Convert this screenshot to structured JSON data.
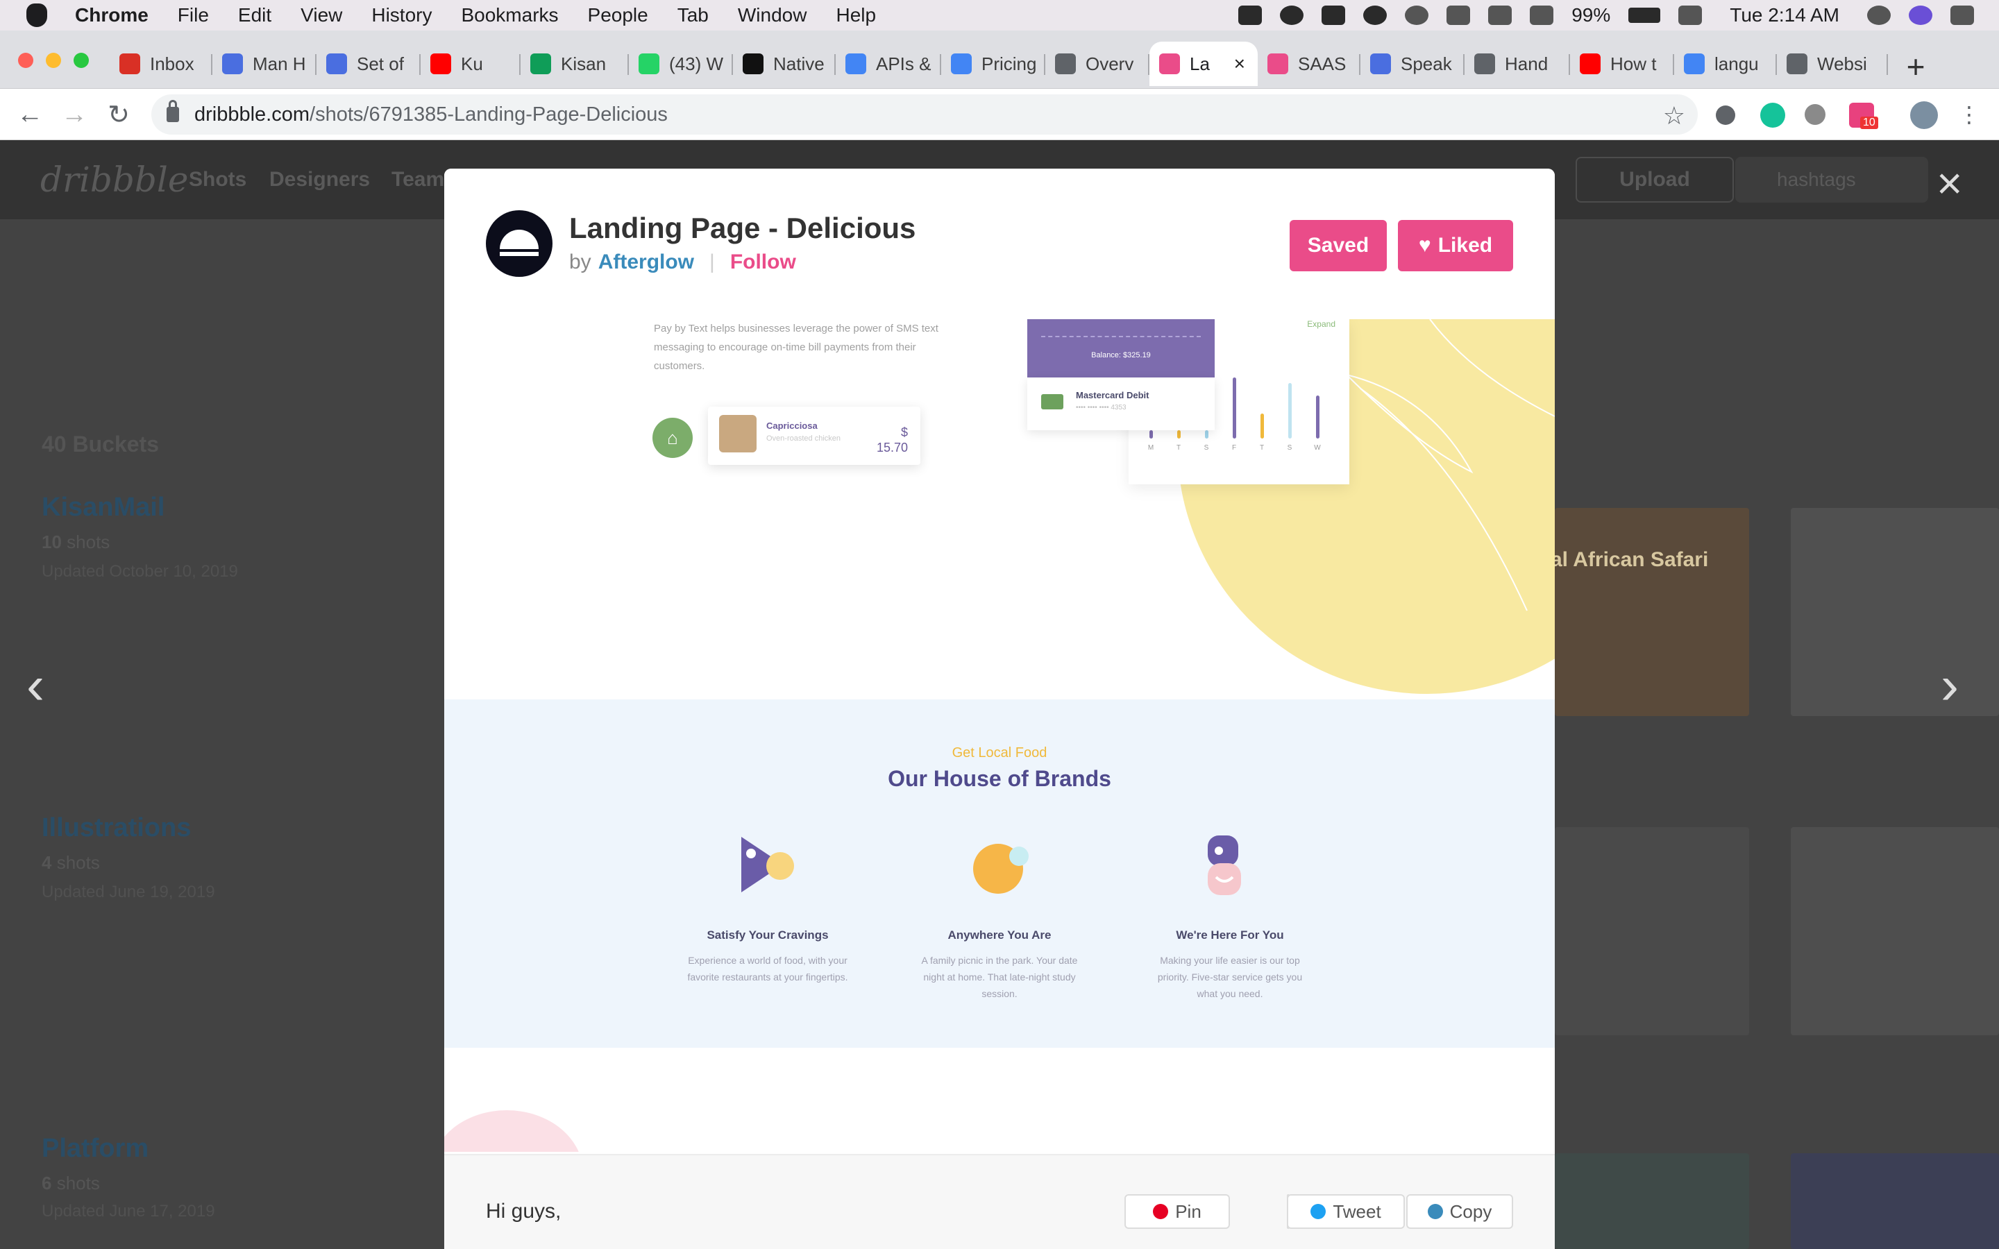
{
  "menubar": {
    "app": "Chrome",
    "items": [
      "File",
      "Edit",
      "View",
      "History",
      "Bookmarks",
      "People",
      "Tab",
      "Window",
      "Help"
    ],
    "battery": "99%",
    "clock": "Tue 2:14 AM"
  },
  "tabs": [
    {
      "title": "Inbox",
      "icon": "gmail-icon",
      "color": "#d93025"
    },
    {
      "title": "Man H",
      "icon": "reddit-icon",
      "color": "#4a6ee0"
    },
    {
      "title": "Set of",
      "icon": "reddit-icon",
      "color": "#4a6ee0"
    },
    {
      "title": "Ku",
      "icon": "youtube-icon",
      "color": "#ff0000"
    },
    {
      "title": "Kisan",
      "icon": "sheets-icon",
      "color": "#0f9d58"
    },
    {
      "title": "(43) W",
      "icon": "whatsapp-icon",
      "color": "#25d366"
    },
    {
      "title": "Native",
      "icon": "medium-icon",
      "color": "#111111"
    },
    {
      "title": "APIs &",
      "icon": "api-icon",
      "color": "#4285f4"
    },
    {
      "title": "Pricing",
      "icon": "gcloud-icon",
      "color": "#4285f4"
    },
    {
      "title": "Overv",
      "icon": "gear-icon",
      "color": "#5f6368"
    },
    {
      "title": "La",
      "icon": "dribbble-icon",
      "color": "#ea4c89",
      "active": true
    },
    {
      "title": "SAAS",
      "icon": "dribbble-icon",
      "color": "#ea4c89"
    },
    {
      "title": "Speak",
      "icon": "reddit-icon",
      "color": "#4a6ee0"
    },
    {
      "title": "Hand",
      "icon": "globe-icon",
      "color": "#5f6368"
    },
    {
      "title": "How t",
      "icon": "youtube-icon",
      "color": "#ff0000"
    },
    {
      "title": "langu",
      "icon": "google-icon",
      "color": "#4285f4"
    },
    {
      "title": "Websi",
      "icon": "globe-icon",
      "color": "#5f6368"
    }
  ],
  "toolbar": {
    "url_host": "dribbble.com",
    "url_path": "/shots/6791385-Landing-Page-Delicious",
    "ext_badge": "10"
  },
  "background_page": {
    "logo": "dribbble",
    "nav": [
      "Shots",
      "Designers",
      "Teams"
    ],
    "upload": "Upload",
    "search_placeholder": "hashtags",
    "buckets_count": "40 Buckets",
    "buckets": [
      {
        "name": "KisanMail",
        "count": "10",
        "unit": "shots",
        "updated": "Updated October 10, 2019"
      },
      {
        "name": "Illustrations",
        "count": "4",
        "unit": "shots",
        "updated": "Updated June 19, 2019"
      },
      {
        "name": "Platform",
        "count": "6",
        "unit": "shots",
        "updated": "Updated June 17, 2019"
      }
    ],
    "thumb_text": "al African Safari"
  },
  "modal": {
    "title": "Landing Page - Delicious",
    "by": "by",
    "author": "Afterglow",
    "follow": "Follow",
    "saved": "Saved",
    "liked": "Liked"
  },
  "shot": {
    "intro": "Pay by Text helps businesses leverage the power of SMS text messaging to encourage on-time bill payments from their customers.",
    "dish_name": "Capricciosa",
    "dish_desc": "Oven-roasted chicken",
    "price_symbol": "$",
    "price": "15.70",
    "balance": "Balance: $325.19",
    "card_name": "Mastercard Debit",
    "card_number": "•••• •••• •••• 4353",
    "expand": "Expand",
    "days": [
      "M",
      "T",
      "S",
      "F",
      "T",
      "S",
      "W"
    ],
    "eyebrow": "Get Local Food",
    "brands_title": "Our House of Brands",
    "features": [
      {
        "title": "Satisfy Your Cravings",
        "desc": "Experience a world of food, with your favorite restaurants at your fingertips."
      },
      {
        "title": "Anywhere You Are",
        "desc": "A family picnic in the park. Your date night at home. That late-night study session."
      },
      {
        "title": "We're Here For You",
        "desc": "Making your life easier is our top priority. Five-star service gets you what you need."
      }
    ]
  },
  "footer": {
    "description": "Hi guys,",
    "pin": "Pin",
    "tweet": "Tweet",
    "copy": "Copy"
  },
  "colors": {
    "dribbble_pink": "#ea4c89",
    "author_blue": "#3a8bbb",
    "brand_purple": "#4f4a8c",
    "accent_yellow": "#f0b93b"
  }
}
